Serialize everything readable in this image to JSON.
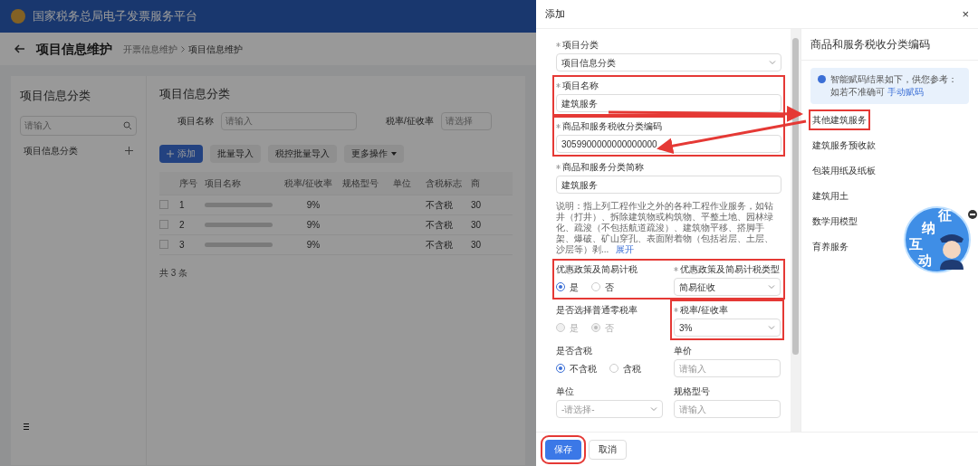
{
  "header": {
    "title": "国家税务总局电子发票服务平台"
  },
  "page": {
    "title": "项目信息维护",
    "breadcrumb": [
      "开票信息维护",
      "项目信息维护"
    ]
  },
  "category_panel": {
    "title": "项目信息分类",
    "search": {
      "placeholder": "请输入"
    },
    "items": [
      {
        "label": "项目信息分类"
      }
    ]
  },
  "main": {
    "title": "项目信息分类",
    "filters": [
      {
        "label": "项目名称",
        "placeholder": "请输入"
      },
      {
        "label": "税率/征收率",
        "placeholder": "请选择"
      }
    ],
    "buttons": [
      {
        "label": "添加",
        "kind": "primary"
      },
      {
        "label": "批量导入",
        "kind": "default"
      },
      {
        "label": "税控批量导入",
        "kind": "default"
      },
      {
        "label": "更多操作",
        "kind": "dropdown"
      }
    ],
    "table": {
      "columns": [
        "序号",
        "项目名称",
        "税率/征收率",
        "规格型号",
        "单位",
        "含税标志",
        "商"
      ],
      "rows": [
        {
          "checked": false,
          "index": "1",
          "rate": "9%",
          "tax_flag": "不含税",
          "column_7": "30"
        },
        {
          "checked": false,
          "index": "2",
          "rate": "9%",
          "tax_flag": "不含税",
          "column_7": "30"
        },
        {
          "checked": false,
          "index": "3",
          "rate": "9%",
          "tax_flag": "不含税",
          "column_7": "30"
        }
      ]
    },
    "total": "共 3 条"
  },
  "dialog": {
    "title": "添加",
    "close": "×",
    "rows": [
      {
        "annotated": false,
        "fields": [
          {
            "kind": "select",
            "label": "项目分类",
            "required": true,
            "annotated": false,
            "value": "项目信息分类"
          }
        ]
      },
      {
        "annotated": false,
        "fields": [
          {
            "kind": "input",
            "label": "项目名称",
            "required": true,
            "annotated": true,
            "value": "建筑服务"
          }
        ]
      },
      {
        "annotated": false,
        "fields": [
          {
            "kind": "input",
            "label": "商品和服务税收分类编码",
            "required": true,
            "annotated": true,
            "value": "3059900000000000000"
          }
        ]
      },
      {
        "annotated": false,
        "fields": [
          {
            "kind": "input",
            "label": "商品和服务分类简称",
            "required": true,
            "annotated": false,
            "value": "建筑服务"
          }
        ]
      },
      {
        "annotated": false,
        "fields": [
          {
            "kind": "note",
            "annotated": false,
            "text": "说明：指上列工程作业之外的各种工程作业服务，如钻井（打井）、拆除建筑物或构筑物、平整土地、园林绿化、疏浚（不包括航道疏浚）、建筑物平移、搭脚手架、爆破、矿山穿孔、表面附着物（包括岩层、土层、沙层等）剥...",
            "link": "展开"
          }
        ]
      },
      {
        "annotated": true,
        "fields": [
          {
            "kind": "radio",
            "label": "优惠政策及简易计税",
            "required": false,
            "annotated": false,
            "disabled": false,
            "options": [
              {
                "label": "是",
                "selected": true
              },
              {
                "label": "否",
                "selected": false
              }
            ]
          },
          {
            "kind": "select",
            "label": "优惠政策及简易计税类型",
            "required": true,
            "annotated": false,
            "value": "简易征收"
          }
        ]
      },
      {
        "annotated": false,
        "fields": [
          {
            "kind": "radio",
            "label": "是否选择普通零税率",
            "required": false,
            "annotated": false,
            "disabled": true,
            "options": [
              {
                "label": "是",
                "selected": false
              },
              {
                "label": "否",
                "selected": true
              }
            ]
          },
          {
            "kind": "select",
            "label": "税率/征收率",
            "required": true,
            "annotated": true,
            "value": "3%"
          }
        ]
      },
      {
        "annotated": false,
        "fields": [
          {
            "kind": "radio",
            "label": "是否含税",
            "required": false,
            "annotated": false,
            "disabled": false,
            "options": [
              {
                "label": "不含税",
                "selected": true
              },
              {
                "label": "含税",
                "selected": false
              }
            ]
          },
          {
            "kind": "input",
            "label": "单价",
            "required": false,
            "annotated": false,
            "placeholder": "请输入"
          }
        ]
      },
      {
        "annotated": false,
        "fields": [
          {
            "kind": "select",
            "label": "单位",
            "required": false,
            "annotated": false,
            "placeholder": "-请选择-"
          },
          {
            "kind": "input",
            "label": "规格型号",
            "required": false,
            "annotated": false,
            "placeholder": "请输入"
          }
        ]
      }
    ],
    "buttons": [
      {
        "label": "保存",
        "kind": "primary",
        "annotated": true
      },
      {
        "label": "取消",
        "kind": "default",
        "annotated": false
      }
    ]
  },
  "code_panel": {
    "title": "商品和服务税收分类编码",
    "notice": "智能赋码结果如下，供您参考：如若不准确可",
    "notice_link": "手动赋码",
    "items": [
      {
        "label": "其他建筑服务",
        "annotated": true
      },
      {
        "label": "建筑服务预收款",
        "annotated": false
      },
      {
        "label": "包装用纸及纸板",
        "annotated": false
      },
      {
        "label": "建筑用土",
        "annotated": false
      },
      {
        "label": "数学用模型",
        "annotated": false
      },
      {
        "label": "育养服务",
        "annotated": false
      }
    ]
  },
  "assistant": {
    "characters": [
      "征",
      "纳",
      "互",
      "动"
    ]
  }
}
